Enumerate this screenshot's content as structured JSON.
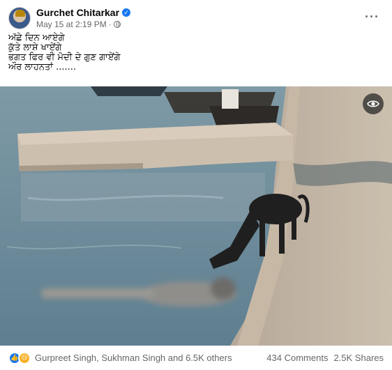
{
  "header": {
    "author": "Gurchet Chitarkar",
    "timestamp": "May 15 at 2:19 PM",
    "audience_icon": "globe-icon",
    "more_icon": "more-horizontal-icon"
  },
  "caption": {
    "lines": [
      "ਅੱਛੇ ਦਿਨ ਆਏਗੇ",
      "ਕੁੱਤੇ ਲਾਸ਼ੇ ਖਾਏਂਗੇ",
      "ਭਗਤ ਫਿਰ ਵੀ ਮੋਦੀ ਦੇ ਗੁਣ ਗਾਏਂਗੇ",
      "ਔਰ ਲਾਹਨਤਾਂ ......."
    ]
  },
  "photo": {
    "overlay_icon": "eye-icon"
  },
  "footer": {
    "reactions": [
      "like-icon",
      "sad-icon"
    ],
    "reactors": "Gurpreet Singh, Sukhman Singh and 6.5K others",
    "comments": "434 Comments",
    "shares": "2.5K Shares"
  },
  "colors": {
    "accent": "#1877f2",
    "secondary_text": "#65676b"
  }
}
